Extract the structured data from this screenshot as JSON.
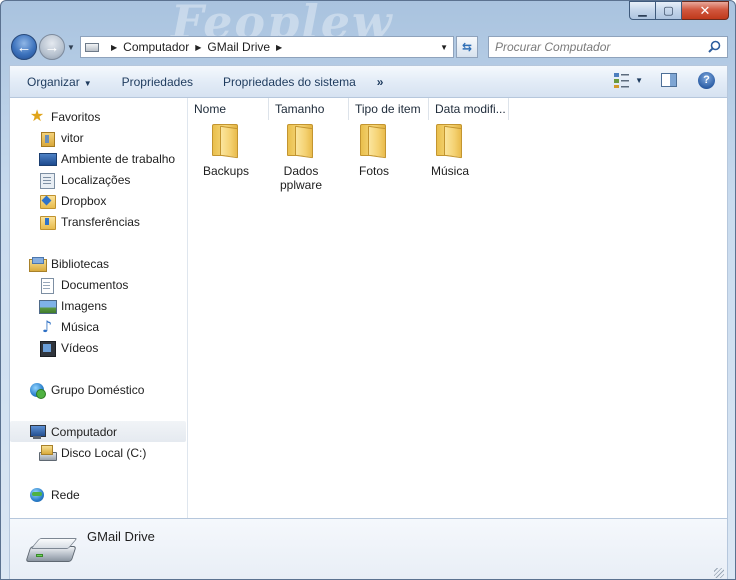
{
  "window": {
    "title_art": "Feoplew",
    "caption": {
      "minimize": "▁",
      "maximize": "▢",
      "close": "✕"
    }
  },
  "address": {
    "breadcrumbs": [
      "Computador",
      "GMail Drive"
    ],
    "search_placeholder": "Procurar Computador"
  },
  "toolbar": {
    "organize_label": "Organizar",
    "properties_label": "Propriedades",
    "system_properties_label": "Propriedades do sistema",
    "more_label": "»",
    "help_label": "?"
  },
  "sidebar": {
    "favorites": {
      "label": "Favoritos",
      "items": [
        "vitor",
        "Ambiente de trabalho",
        "Localizações",
        "Dropbox",
        "Transferências"
      ]
    },
    "libraries": {
      "label": "Bibliotecas",
      "items": [
        "Documentos",
        "Imagens",
        "Música",
        "Vídeos"
      ]
    },
    "homegroup": {
      "label": "Grupo Doméstico"
    },
    "computer": {
      "label": "Computador",
      "items": [
        "Disco Local (C:)"
      ]
    },
    "network": {
      "label": "Rede"
    }
  },
  "columns": [
    "Nome",
    "Tamanho",
    "Tipo de item",
    "Data modifi..."
  ],
  "files": [
    {
      "name": "Backups",
      "icon": "folder-icon"
    },
    {
      "name": "Dados pplware",
      "icon": "folder-icon"
    },
    {
      "name": "Fotos",
      "icon": "folder-icon"
    },
    {
      "name": "Música",
      "icon": "folder-icon"
    }
  ],
  "details": {
    "title": "GMail Drive",
    "icon": "drive-icon"
  },
  "colors": {
    "frame": "#c9dbee",
    "toolbar": "#e3ecf7",
    "close_button": "#c0391b",
    "selected_nav": "#e5eaf0"
  }
}
